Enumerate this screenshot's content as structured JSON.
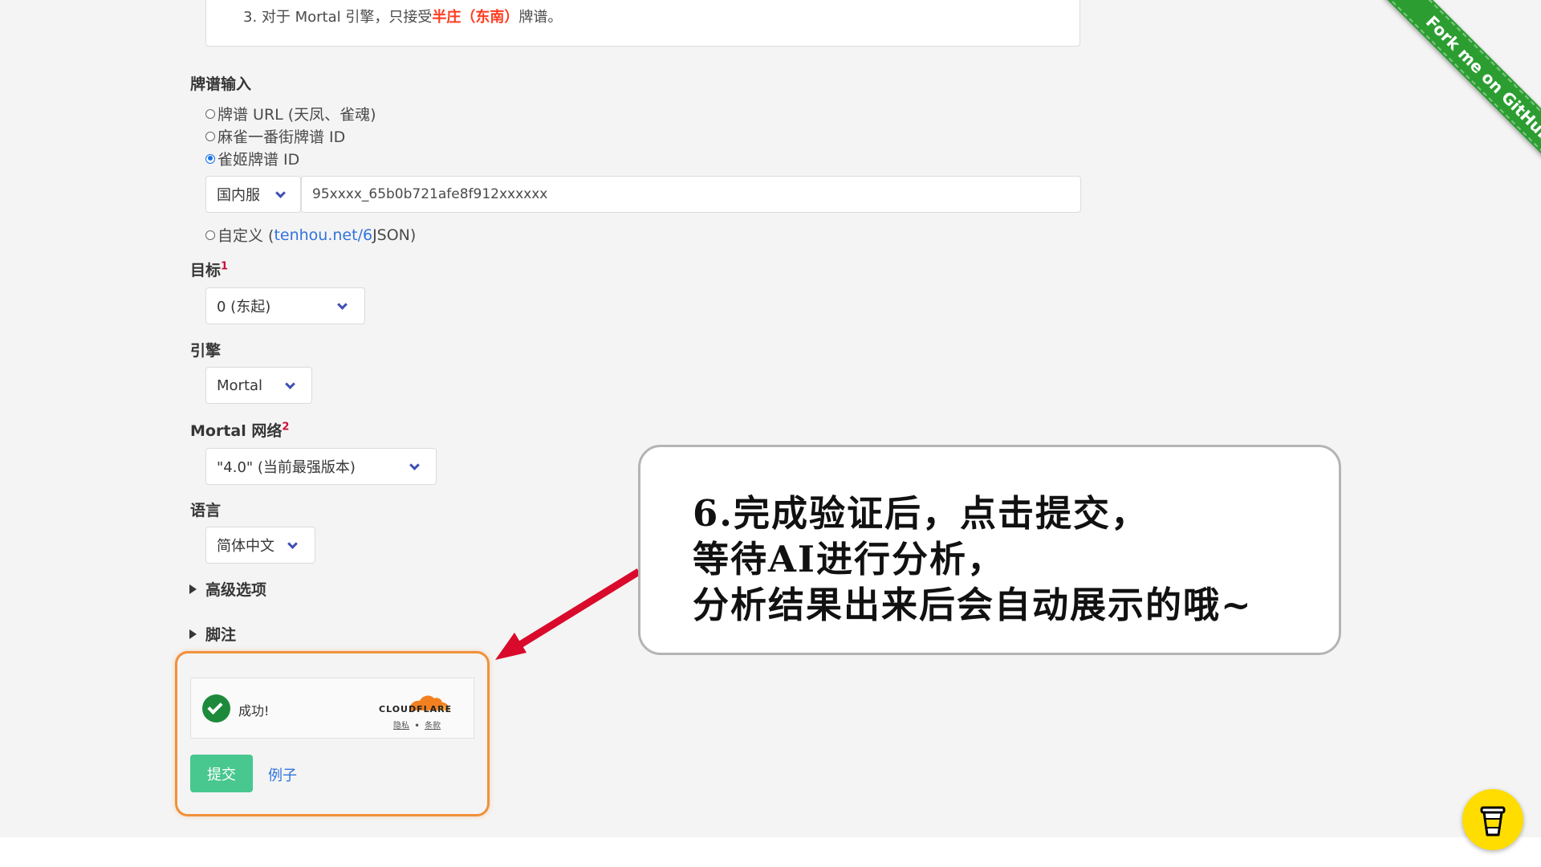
{
  "notice": {
    "line_prefix": "3. 对于 Mortal 引擎，只接受",
    "line_highlight": "半庄（东南）",
    "line_suffix": "牌谱。"
  },
  "form": {
    "paipu_input": {
      "label": "牌谱输入",
      "options": [
        {
          "label": "牌谱 URL (天凤、雀魂)",
          "checked": false
        },
        {
          "label": "麻雀一番街牌谱 ID",
          "checked": false
        },
        {
          "label": "雀姬牌谱 ID",
          "checked": true
        }
      ],
      "server_select": "国内服",
      "id_value": "95xxxx_65b0b721afe8f912xxxxxx",
      "custom_prefix": "自定义 (",
      "custom_link": "tenhou.net/6",
      "custom_suffix": " JSON)"
    },
    "target": {
      "label": "目标",
      "footnote": "1",
      "value": "0 (东起)"
    },
    "engine": {
      "label": "引擎",
      "value": "Mortal"
    },
    "network": {
      "label": "Mortal 网络",
      "footnote": "2",
      "value": "\"4.0\" (当前最强版本)"
    },
    "language": {
      "label": "语言",
      "value": "简体中文"
    },
    "advanced_label": "高级选项",
    "footnotes_label": "脚注"
  },
  "turnstile": {
    "status": "成功!",
    "brand": "CLOUDFLARE",
    "privacy": "隐私",
    "separator": "•",
    "terms": "条款",
    "brand_color": "#f38020"
  },
  "actions": {
    "submit": "提交",
    "example": "例子"
  },
  "callout": {
    "line1": "6.完成验证后，点击提交，",
    "line2": "等待AI进行分析，",
    "line3": "分析结果出来后会自动展示的哦~"
  },
  "ribbon": {
    "text": "Fork me on GitHub",
    "color": "#2c9e31"
  },
  "coffee": {
    "icon": "coffee-cup-icon",
    "color": "#ffdd00"
  }
}
